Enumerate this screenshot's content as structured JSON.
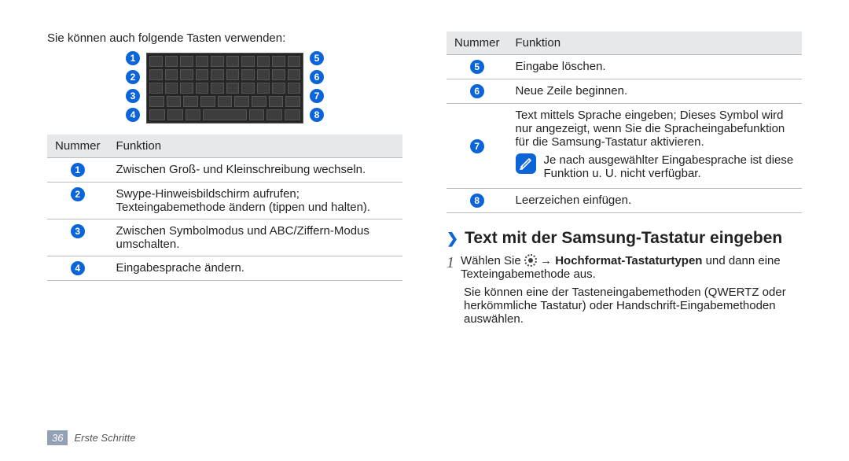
{
  "left": {
    "intro": "Sie können auch folgende Tasten verwenden:",
    "callouts": {
      "l1": "1",
      "l2": "2",
      "l3": "3",
      "l4": "4",
      "r1": "5",
      "r2": "6",
      "r3": "7",
      "r4": "8"
    },
    "thead": {
      "num": "Nummer",
      "fn": "Funktion"
    },
    "rows": [
      {
        "n": "1",
        "fn": "Zwischen Groß- und Kleinschreibung wechseln."
      },
      {
        "n": "2",
        "fn": "Swype-Hinweisbildschirm aufrufen; Texteingabemethode ändern (tippen und halten)."
      },
      {
        "n": "3",
        "fn": "Zwischen Symbolmodus und ABC/Ziffern-Modus umschalten."
      },
      {
        "n": "4",
        "fn": "Eingabesprache ändern."
      }
    ]
  },
  "right": {
    "thead": {
      "num": "Nummer",
      "fn": "Funktion"
    },
    "rows": [
      {
        "n": "5",
        "fn": "Eingabe löschen."
      },
      {
        "n": "6",
        "fn": "Neue Zeile beginnen."
      },
      {
        "n": "7",
        "fn": "Text mittels Sprache eingeben; Dieses Symbol wird nur angezeigt, wenn Sie die Spracheingabefunktion für die Samsung-Tastatur aktivieren.",
        "note": "Je nach ausgewählter Eingabesprache ist diese Funktion u. U. nicht verfügbar."
      },
      {
        "n": "8",
        "fn": "Leerzeichen einfügen."
      }
    ],
    "section_title": "Text mit der Samsung-Tastatur eingeben",
    "step1_prefix": "Wählen Sie ",
    "step1_arrow": " → ",
    "step1_bold": "Hochformat-Tastaturtypen",
    "step1_suffix": " und dann eine Texteingabemethode aus.",
    "step1_explain": "Sie können eine der Tasteneingabemethoden (QWERTZ oder herkömmliche Tastatur) oder Handschrift-Eingabemethoden auswählen."
  },
  "footer": {
    "page": "36",
    "chapter": "Erste Schritte"
  }
}
